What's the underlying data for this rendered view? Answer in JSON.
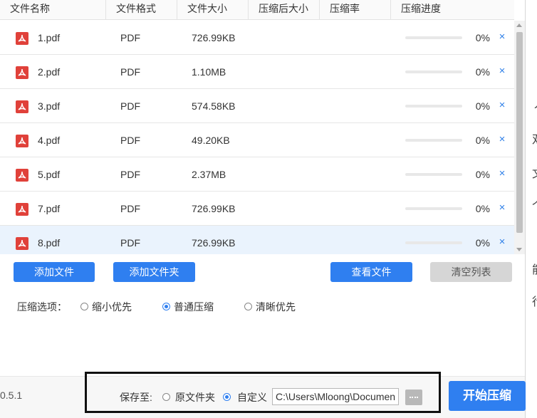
{
  "table": {
    "headers": [
      "文件名称",
      "文件格式",
      "文件大小",
      "压缩后大小",
      "压缩率",
      "压缩进度"
    ],
    "rows": [
      {
        "name": "1.pdf",
        "format": "PDF",
        "size": "726.99KB",
        "progress": 0,
        "progress_text": "0%"
      },
      {
        "name": "2.pdf",
        "format": "PDF",
        "size": "1.10MB",
        "progress": 0,
        "progress_text": "0%"
      },
      {
        "name": "3.pdf",
        "format": "PDF",
        "size": "574.58KB",
        "progress": 0,
        "progress_text": "0%"
      },
      {
        "name": "4.pdf",
        "format": "PDF",
        "size": "49.20KB",
        "progress": 0,
        "progress_text": "0%"
      },
      {
        "name": "5.pdf",
        "format": "PDF",
        "size": "2.37MB",
        "progress": 0,
        "progress_text": "0%"
      },
      {
        "name": "7.pdf",
        "format": "PDF",
        "size": "726.99KB",
        "progress": 0,
        "progress_text": "0%"
      },
      {
        "name": "8.pdf",
        "format": "PDF",
        "size": "726.99KB",
        "progress": 0,
        "progress_text": "0%",
        "selected": true
      }
    ],
    "remove_icon": "×"
  },
  "buttons": {
    "add_file": "添加文件",
    "add_folder": "添加文件夹",
    "view_files": "查看文件",
    "clear_list": "清空列表",
    "start": "开始压缩"
  },
  "options": {
    "label": "压缩选项：",
    "choices": [
      {
        "label": "缩小优先",
        "checked": false
      },
      {
        "label": "普通压缩",
        "checked": true
      },
      {
        "label": "清晰优先",
        "checked": false
      }
    ]
  },
  "footer": {
    "version": "0.5.1",
    "save_label": "保存至:",
    "save_choices": [
      {
        "label": "原文件夹",
        "checked": false
      },
      {
        "label": "自定义",
        "checked": true
      }
    ],
    "path_value": "C:\\Users\\Mloong\\Documents"
  },
  "right_strip_chars": [
    "丿",
    "双",
    "文",
    "个",
    "能",
    "行"
  ],
  "colors": {
    "accent": "#2f7ff0",
    "pdf_icon": "#e0413a",
    "selected_row": "#eaf3fd",
    "clear_button": "#d6d6d6"
  },
  "icons": {
    "pdf": "pdf-icon",
    "remove": "close-icon",
    "browse": "folder-browse-icon"
  }
}
